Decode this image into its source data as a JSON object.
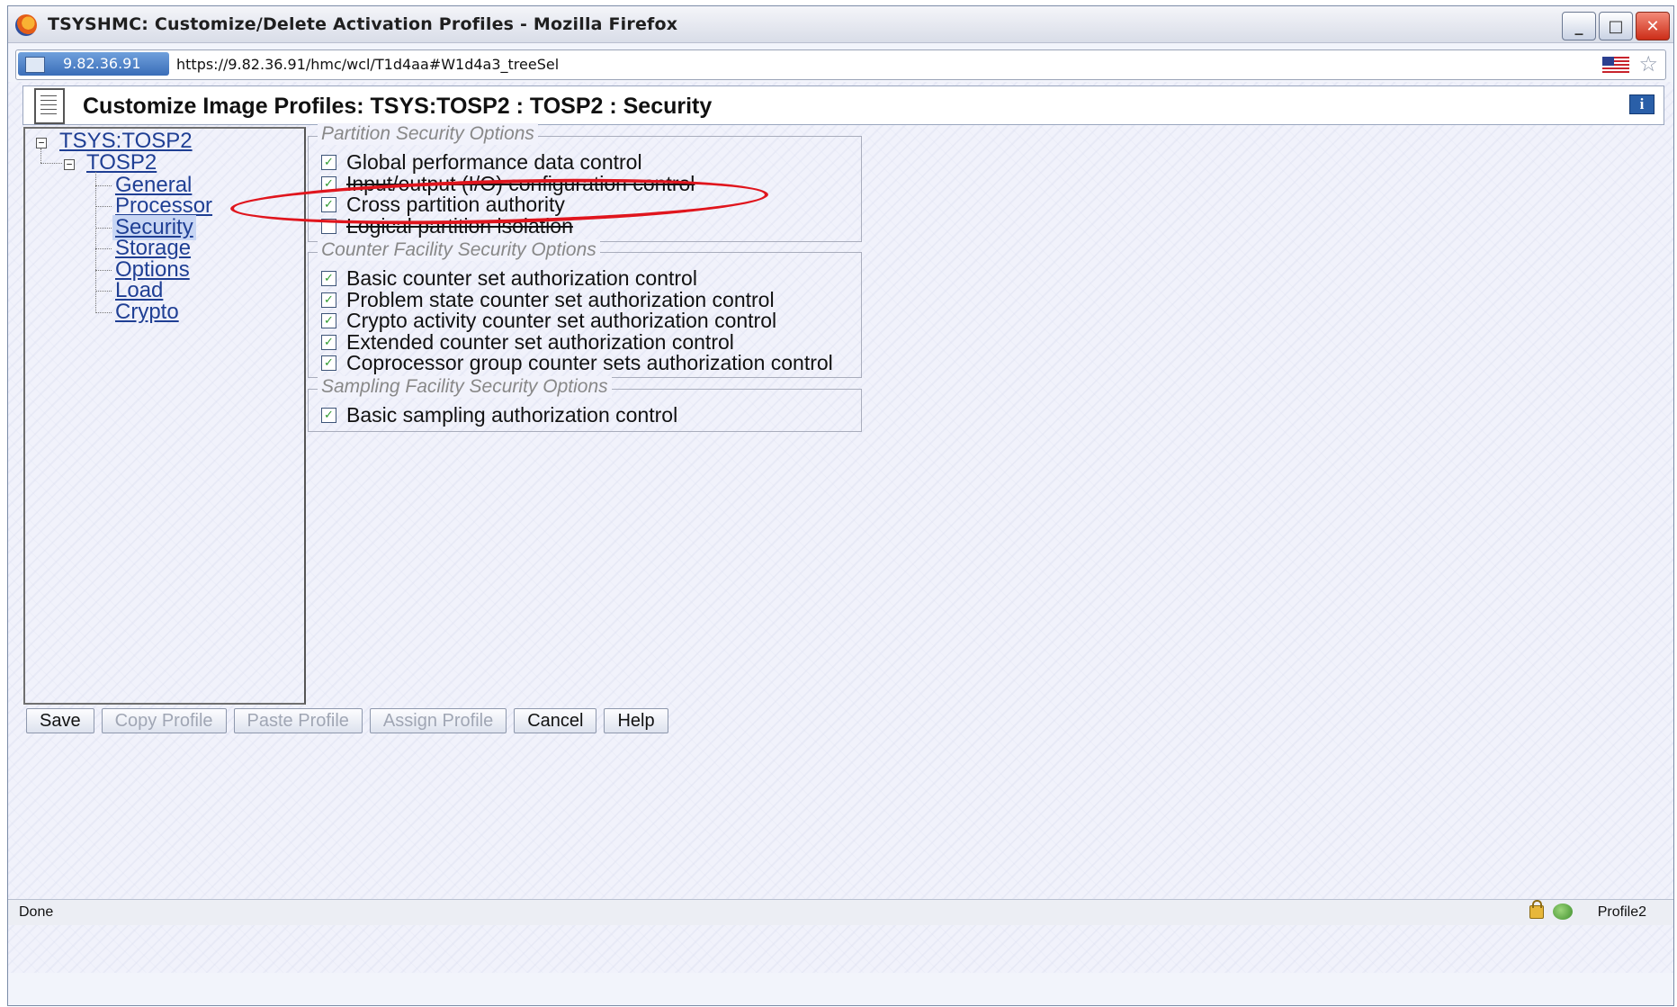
{
  "window": {
    "title": "TSYSHMC: Customize/Delete Activation Profiles - Mozilla Firefox",
    "minimize": "_",
    "maximize": "□",
    "close": "✕"
  },
  "urlbar": {
    "site_ip": "9.82.36.91",
    "url": "https://9.82.36.91/hmc/wcl/T1d4aa#W1d4a3_treeSel"
  },
  "header": {
    "title": "Customize Image Profiles: TSYS:TOSP2 : TOSP2 : Security",
    "info_glyph": "i"
  },
  "tree": {
    "root": "TSYS:TOSP2",
    "profile": "TOSP2",
    "expander_glyph": "−",
    "items": [
      "General",
      "Processor",
      "Security",
      "Storage",
      "Options",
      "Load",
      "Crypto"
    ],
    "selected": "Security"
  },
  "groups": [
    {
      "title": "Partition Security Options",
      "options": [
        {
          "label": "Global performance data control",
          "checked": true
        },
        {
          "label": "Input/output (I/O) configuration control",
          "checked": true
        },
        {
          "label": "Cross partition authority",
          "checked": true
        },
        {
          "label": "Logical partition isolation",
          "checked": false
        }
      ]
    },
    {
      "title": "Counter Facility Security Options",
      "options": [
        {
          "label": "Basic counter set authorization control",
          "checked": true
        },
        {
          "label": "Problem state counter set authorization control",
          "checked": true
        },
        {
          "label": "Crypto activity counter set authorization control",
          "checked": true
        },
        {
          "label": "Extended counter set authorization control",
          "checked": true
        },
        {
          "label": "Coprocessor group counter sets authorization control",
          "checked": true
        }
      ]
    },
    {
      "title": "Sampling Facility Security Options",
      "options": [
        {
          "label": "Basic sampling authorization control",
          "checked": true
        }
      ]
    }
  ],
  "check_glyph": "✓",
  "buttons": [
    {
      "label": "Save",
      "enabled": true
    },
    {
      "label": "Copy Profile",
      "enabled": false
    },
    {
      "label": "Paste Profile",
      "enabled": false
    },
    {
      "label": "Assign Profile",
      "enabled": false
    },
    {
      "label": "Cancel",
      "enabled": true
    },
    {
      "label": "Help",
      "enabled": true
    }
  ],
  "status": {
    "text": "Done",
    "profile": "Profile2"
  },
  "annotation": {
    "highlight_color": "#e0151d"
  }
}
